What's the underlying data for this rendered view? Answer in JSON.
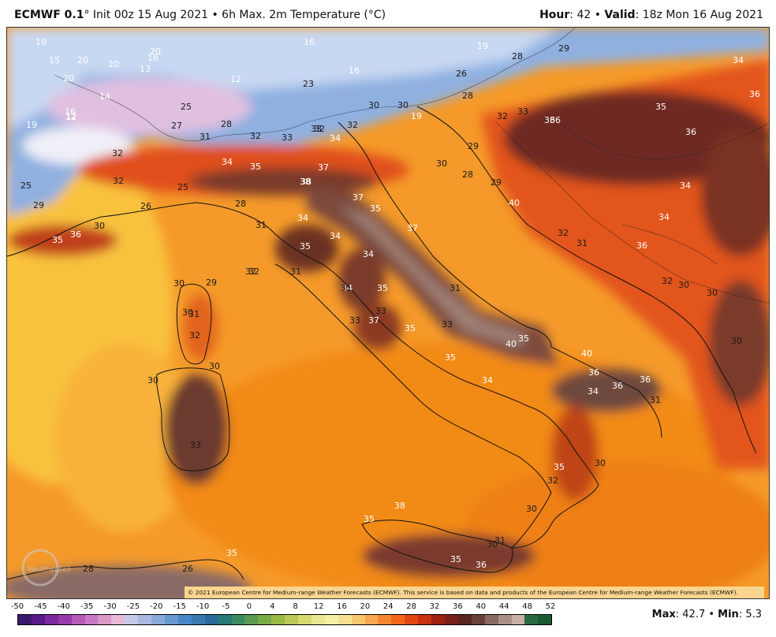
{
  "header": {
    "model": "ECMWF 0.1",
    "degree": "°",
    "init": " Init 00z 15 Aug 2021 • 6h Max. 2m Temperature (°C)",
    "hour_label": "Hour",
    "hour_value": ": 42 • ",
    "valid_label": "Valid",
    "valid_value": ": 18z Mon 16 Aug 2021"
  },
  "copyright": "© 2021 European Centre for Medium-range Weather Forecasts (ECMWF). This service is based on data and products of the European Centre for Medium-range Weather Forecasts (ECMWF).",
  "watermark": "WeatherBell",
  "scale": {
    "ticks": [
      "-50",
      "-45",
      "-40",
      "-35",
      "-30",
      "-25",
      "-20",
      "-15",
      "-10",
      "-5",
      "0",
      "4",
      "8",
      "12",
      "16",
      "20",
      "24",
      "28",
      "32",
      "36",
      "40",
      "44",
      "48",
      "52"
    ],
    "colors": [
      "#3a1a6e",
      "#5a1a8a",
      "#7a2a9a",
      "#9a3aaa",
      "#b85ab8",
      "#c878c8",
      "#d898c8",
      "#e8b8d8",
      "#c8c8e8",
      "#a8b8e0",
      "#88a8d8",
      "#6898d0",
      "#4888c8",
      "#3878b0",
      "#2a6a98",
      "#2a7a78",
      "#3a8a60",
      "#5a9a50",
      "#7aaa48",
      "#9aba48",
      "#bac858",
      "#d8d870",
      "#e8e890",
      "#f4f0a8",
      "#f8e090",
      "#f8c870",
      "#f8a850",
      "#f48830",
      "#f06818",
      "#e04810",
      "#c83010",
      "#a02010",
      "#782018",
      "#582820",
      "#6a4038",
      "#8a6a60",
      "#a89088",
      "#c8b0a8",
      "#2a6a40",
      "#1a5a30"
    ]
  },
  "stats": {
    "max_label": "Max",
    "max_value": ": 42.7 • ",
    "min_label": "Min",
    "min_value": ": 5.3"
  },
  "labels": [
    "19",
    "15",
    "20",
    "20",
    "20",
    "16",
    "16",
    "16",
    "19",
    "28",
    "29",
    "34",
    "13",
    "20",
    "14",
    "12",
    "16",
    "12",
    "23",
    "26",
    "28",
    "30",
    "33",
    "36",
    "35",
    "36",
    "19",
    "12",
    "25",
    "27",
    "28",
    "31",
    "32",
    "33",
    "34",
    "32",
    "32",
    "30",
    "19",
    "38",
    "32",
    "33",
    "36",
    "32",
    "34",
    "35",
    "37",
    "38",
    "37",
    "35",
    "30",
    "29",
    "28",
    "32",
    "36",
    "34",
    "25",
    "25",
    "29",
    "35",
    "36",
    "30",
    "26",
    "28",
    "31",
    "34",
    "34",
    "35",
    "37",
    "32",
    "34",
    "31",
    "34",
    "35",
    "31",
    "32",
    "30",
    "29",
    "31",
    "32",
    "31",
    "37",
    "33",
    "35",
    "33",
    "34",
    "30",
    "29",
    "30",
    "30",
    "35",
    "40",
    "40",
    "36",
    "36",
    "36",
    "34",
    "31",
    "35",
    "33",
    "30",
    "30",
    "30",
    "40",
    "31",
    "36",
    "34",
    "32",
    "32",
    "32",
    "30",
    "30",
    "35",
    "35",
    "38",
    "30",
    "31",
    "33",
    "35",
    "36",
    "26",
    "35",
    "28"
  ]
}
